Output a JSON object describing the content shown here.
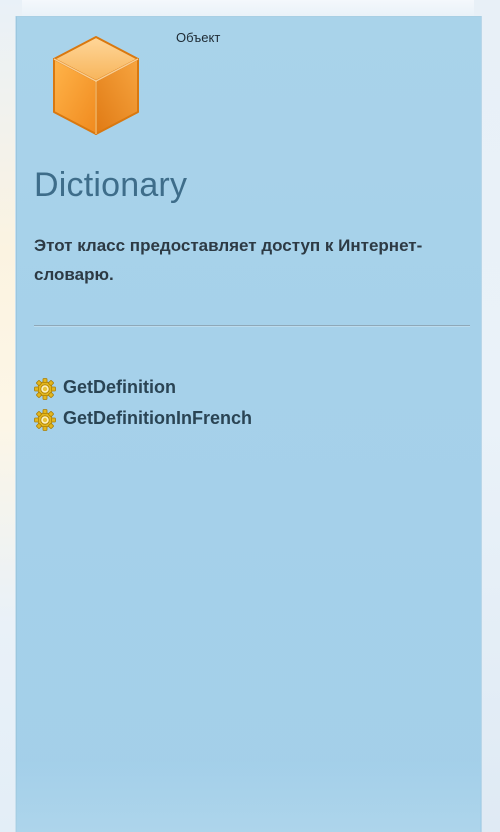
{
  "object_panel": {
    "type_label": "Объект",
    "icon": "cube-icon",
    "title": "Dictionary",
    "description": "Этот класс предоставляет доступ к Интернет-словарю.",
    "methods": [
      {
        "name": "GetDefinition",
        "icon": "gear-icon"
      },
      {
        "name": "GetDefinitionInFrench",
        "icon": "gear-icon"
      }
    ]
  },
  "colors": {
    "panel_background": "#a6d1ea",
    "title_color": "#3e6d8a",
    "text_color": "#2d3a44",
    "cube_orange": "#f39a2c",
    "gear_yellow": "#e3b61c"
  }
}
